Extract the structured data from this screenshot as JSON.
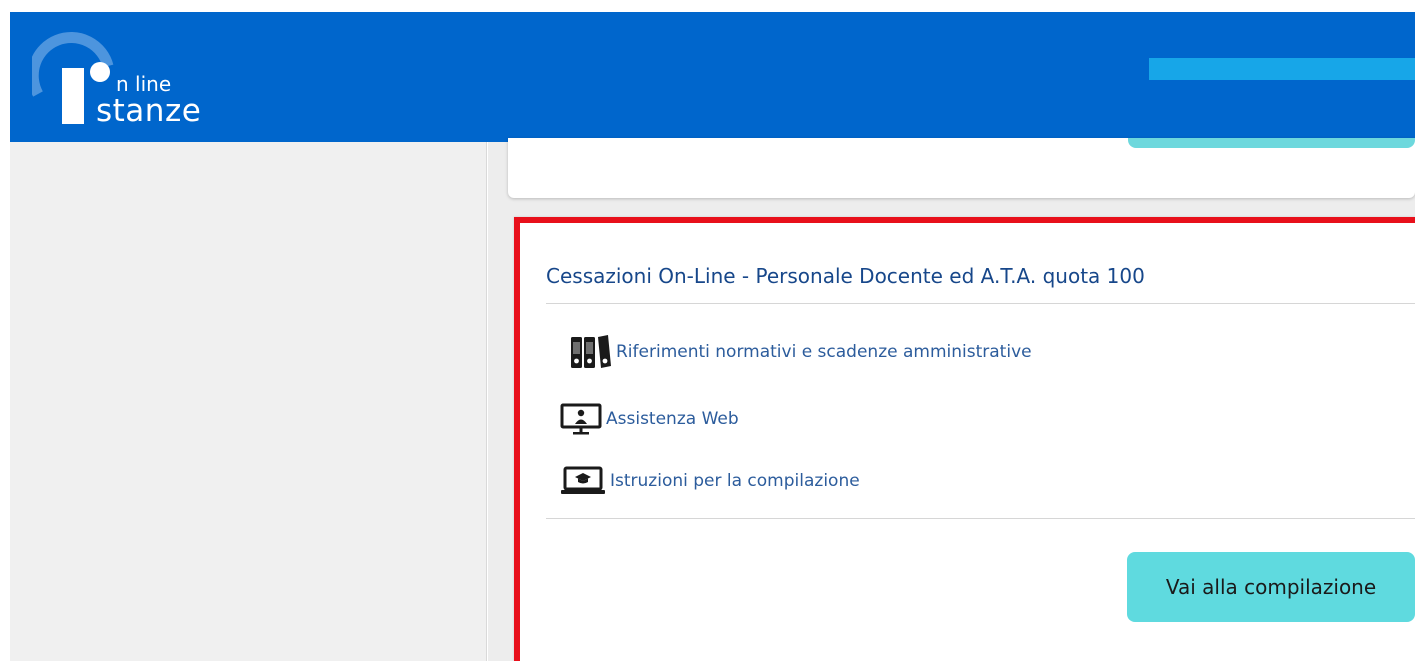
{
  "logo": {
    "line1": "n line",
    "line2": "stanze"
  },
  "card": {
    "title": "Cessazioni On-Line - Personale Docente ed A.T.A. quota 100",
    "links": [
      {
        "label": "Riferimenti normativi e scadenze amministrative",
        "icon": "binders-icon"
      },
      {
        "label": "Assistenza Web",
        "icon": "monitor-user-icon"
      },
      {
        "label": "Istruzioni per la compilazione",
        "icon": "laptop-graduation-icon"
      }
    ],
    "cta_label": "Vai alla compilazione"
  },
  "colors": {
    "header": "#0066cc",
    "accent_stripe": "#17a6e8",
    "highlight_border": "#e8101b",
    "cta": "#5fdadf",
    "title": "#17478a",
    "link": "#2c5c9c"
  }
}
